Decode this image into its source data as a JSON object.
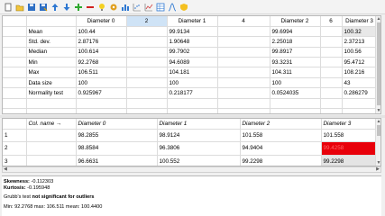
{
  "toolbar": {
    "icons": [
      "new-doc-icon",
      "open-folder-icon",
      "save-icon",
      "save-as-icon",
      "up-arrow-icon",
      "down-arrow-icon",
      "add-icon",
      "remove-icon",
      "bulb-icon",
      "settings-icon",
      "histogram-icon",
      "scatter-icon",
      "chart-icon",
      "table-icon",
      "bell-curve-icon",
      "shield-icon"
    ]
  },
  "stats": {
    "header": [
      "",
      "",
      "Diameter 0",
      "2",
      "Diameter 1",
      "4",
      "Diameter 2",
      "6",
      "Diameter 3"
    ],
    "rows": [
      {
        "label": "Mean",
        "values": [
          "100.44",
          "",
          "99.9134",
          "",
          "99.6994",
          "",
          "100.32"
        ]
      },
      {
        "label": "Std. dev.",
        "values": [
          "2.87176",
          "",
          "1.90648",
          "",
          "2.25018",
          "",
          "2.37213"
        ]
      },
      {
        "label": "Median",
        "values": [
          "100.614",
          "",
          "99.7902",
          "",
          "99.8917",
          "",
          "100.56"
        ]
      },
      {
        "label": "Min",
        "values": [
          "92.2768",
          "",
          "94.6089",
          "",
          "93.3231",
          "",
          "95.4712"
        ]
      },
      {
        "label": "Max",
        "values": [
          "106.511",
          "",
          "104.181",
          "",
          "104.311",
          "",
          "108.216"
        ]
      },
      {
        "label": "Data size",
        "values": [
          "100",
          "",
          "100",
          "",
          "100",
          "",
          "43"
        ]
      },
      {
        "label": "Normality test",
        "values": [
          "0.925967",
          "",
          "0.218177",
          "",
          "0.0524035",
          "",
          "0.286279"
        ]
      },
      {
        "label": "",
        "values": [
          "",
          "",
          "",
          "",
          "",
          "",
          ""
        ]
      },
      {
        "label": "",
        "values": [
          "",
          "",
          "",
          "",
          "",
          "",
          ""
        ]
      }
    ]
  },
  "data": {
    "header": [
      "",
      "Col. name →",
      "Diameter 0",
      "Diameter 1",
      "Diameter 2",
      "Diameter 3"
    ],
    "rows": [
      {
        "num": "1",
        "values": [
          "98.2855",
          "98.9124",
          "101.558",
          "101.558"
        ]
      },
      {
        "num": "2",
        "values": [
          "98.8584",
          "96.3806",
          "94.9404",
          "99.4258"
        ]
      },
      {
        "num": "3",
        "values": [
          "96.6631",
          "100.552",
          "99.2298",
          "99.2298"
        ]
      }
    ]
  },
  "output": {
    "skew_label": "Skewness:",
    "skew_value": " -0.112303",
    "kurt_label": "Kurtosis:",
    "kurt_value": " -0.195948",
    "grubbs_prefix": "Grubb's test ",
    "grubbs_bold": "not significant for outliers",
    "cut_line": "Min: 92.2768   max: 106.511   mean: 100.4400"
  }
}
